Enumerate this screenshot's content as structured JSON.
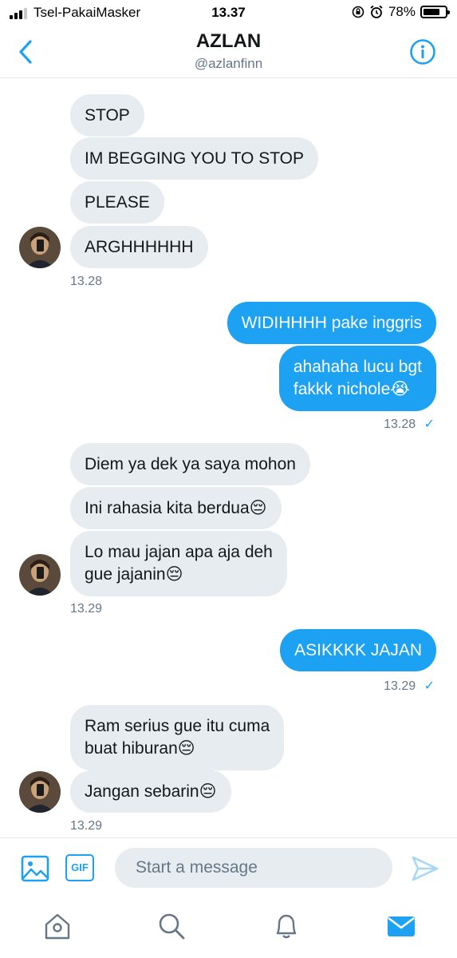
{
  "status_bar": {
    "carrier": "Tsel-PakaiMasker",
    "time": "13.37",
    "battery": "78%",
    "battery_level": 0.78
  },
  "header": {
    "name": "AZLAN",
    "handle": "@azlanfinn"
  },
  "messages": {
    "m1": "STOP",
    "m2": "IM BEGGING YOU TO STOP",
    "m3": "PLEASE",
    "m4": "ARGHHHHHH",
    "t1": "13.28",
    "m5": "WIDIHHHH pake inggris",
    "m6_l1": "ahahaha lucu bgt",
    "m6_l2": "fakkk nichole😭",
    "t2": "13.28",
    "m7": "Diem ya dek ya saya mohon",
    "m8": "Ini rahasia kita berdua😔",
    "m9_l1": "Lo mau jajan apa aja deh",
    "m9_l2": "gue jajanin😔",
    "t3": "13.29",
    "m10": "ASIKKKK JAJAN",
    "t4": "13.29",
    "m11_l1": "Ram serius gue itu cuma",
    "m11_l2": "buat hiburan😔",
    "m12": "Jangan sebarin😔",
    "t5": "13.29"
  },
  "read_mark": "✓",
  "composer": {
    "placeholder": "Start a message",
    "gif_label": "GIF"
  },
  "icons": {
    "back": "chevron-left-icon",
    "info": "info-icon",
    "media": "image-icon",
    "send": "send-icon",
    "home": "home-icon",
    "search": "search-icon",
    "notifications": "bell-icon",
    "messages": "mail-icon"
  },
  "colors": {
    "accent": "#1da1f2",
    "incoming": "#e6ecf0",
    "muted": "#657786"
  }
}
